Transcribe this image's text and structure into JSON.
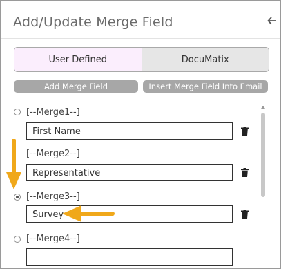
{
  "header": {
    "title": "Add/Update Merge Field"
  },
  "tabs": [
    {
      "label": "User Defined",
      "active": true
    },
    {
      "label": "DocuMatix",
      "active": false
    }
  ],
  "actions": {
    "add_label": "Add Merge Field",
    "insert_label": "Insert Merge Field Into Email"
  },
  "merges": [
    {
      "label": "[--Merge1--]",
      "value": "First Name",
      "selected": false
    },
    {
      "label": "[--Merge2--]",
      "value": "Representative",
      "selected": false
    },
    {
      "label": "[--Merge3--]",
      "value": "Survey",
      "selected": true
    },
    {
      "label": "[--Merge4--]",
      "value": "",
      "selected": false
    }
  ],
  "colors": {
    "accent_arrow": "#f0a81a",
    "active_tab_bg": "#fbeefd",
    "button_bg": "#a7a7a7"
  },
  "icons": {
    "back": "arrow-left-icon",
    "delete": "trash-icon"
  }
}
